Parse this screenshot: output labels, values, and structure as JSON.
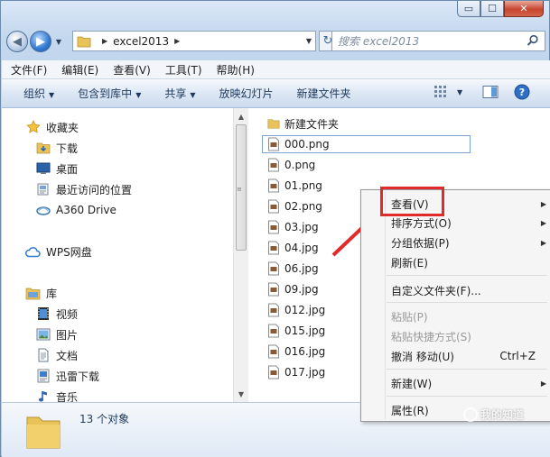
{
  "window": {
    "controls": {
      "minimize": "▭",
      "maximize": "☐",
      "close": "✕"
    },
    "nav": {
      "back": "◀",
      "forward": "▶",
      "history": "▼"
    },
    "address": {
      "path_root_sep": "▶",
      "folder": "excel2013",
      "path_sep": "▶",
      "dropdown": "▼"
    },
    "refresh": "↻",
    "search": {
      "placeholder": "搜索 excel2013"
    }
  },
  "menubar": {
    "file": "文件(F)",
    "edit": "编辑(E)",
    "view": "查看(V)",
    "tools": "工具(T)",
    "help": "帮助(H)"
  },
  "toolbar": {
    "organize": "组织",
    "include": "包含到库中",
    "share": "共享",
    "slideshow": "放映幻灯片",
    "newfolder": "新建文件夹",
    "arrow": "▼"
  },
  "sidebar": {
    "items": [
      {
        "label": "收藏夹"
      },
      {
        "label": "下载"
      },
      {
        "label": "桌面"
      },
      {
        "label": "最近访问的位置"
      },
      {
        "label": "A360 Drive"
      },
      {
        "label": "WPS网盘"
      },
      {
        "label": "库"
      },
      {
        "label": "视频"
      },
      {
        "label": "图片"
      },
      {
        "label": "文档"
      },
      {
        "label": "迅雷下载"
      },
      {
        "label": "音乐"
      }
    ]
  },
  "files": [
    {
      "name": "新建文件夹"
    },
    {
      "name": "000.png"
    },
    {
      "name": "0.png"
    },
    {
      "name": "01.png"
    },
    {
      "name": "02.png"
    },
    {
      "name": "03.jpg"
    },
    {
      "name": "04.jpg"
    },
    {
      "name": "06.jpg"
    },
    {
      "name": "09.jpg"
    },
    {
      "name": "012.jpg"
    },
    {
      "name": "015.jpg"
    },
    {
      "name": "016.jpg"
    },
    {
      "name": "017.jpg"
    }
  ],
  "context_menu": {
    "view": "查看(V)",
    "sort": "排序方式(O)",
    "group": "分组依据(P)",
    "refresh": "刷新(E)",
    "customize": "自定义文件夹(F)...",
    "paste": "粘贴(P)",
    "paste_shortcut": "粘贴快捷方式(S)",
    "undo": "撤消 移动(U)",
    "undo_shortcut": "Ctrl+Z",
    "new": "新建(W)",
    "properties": "属性(R)",
    "submenu_arrow": "▶"
  },
  "status": {
    "count": "13 个对象"
  },
  "watermark": {
    "text": "我的知道"
  },
  "colors": {
    "accent": "#2f78d1",
    "highlight_box": "#e12a2a",
    "annotation_arrow": "#e12a2a",
    "folder": "#e8c35a"
  }
}
